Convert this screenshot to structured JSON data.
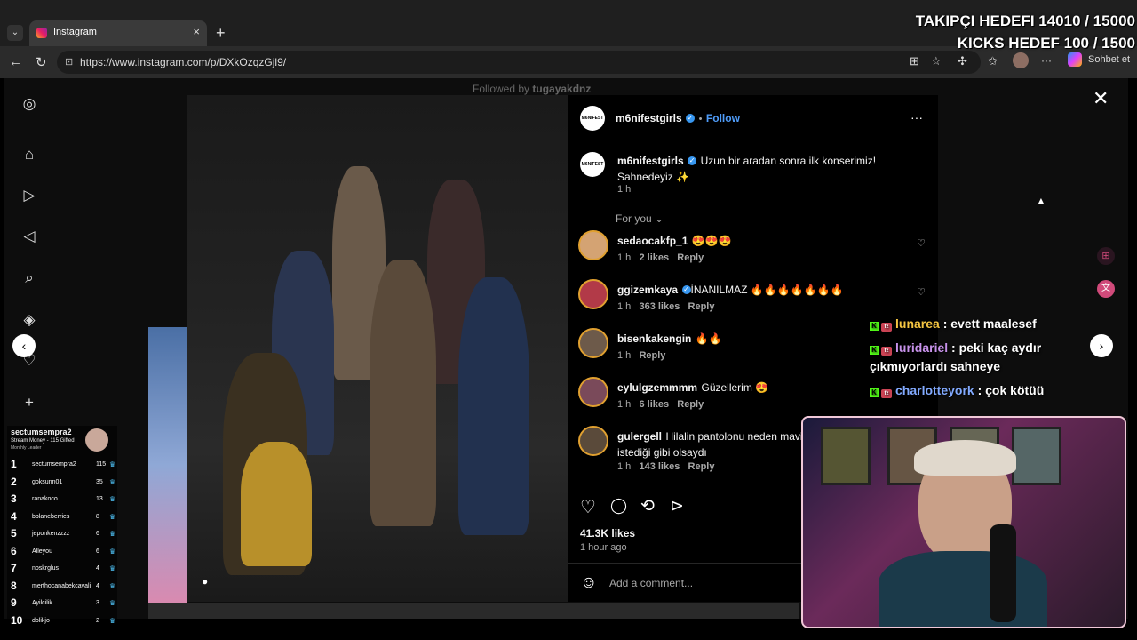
{
  "overlay": {
    "goal_followers": "TAKIPÇI HEDEFI 14010 / 15000",
    "goal_kicks": "KICKS HEDEF 100 / 1500"
  },
  "browser": {
    "tab_title": "Instagram",
    "tab_close": "×",
    "new_tab": "+",
    "url": "https://www.instagram.com/p/DXkOzqzGjl9/",
    "sidebar_btn": "Sohbet et",
    "back": "←",
    "reload": "↻",
    "menu": "···"
  },
  "instagram": {
    "followed_by_prefix": "Followed by",
    "followed_by_user": "tugayakdnz",
    "post": {
      "author": "m6nifestgirls",
      "follow_label": "Follow",
      "dot": "•",
      "more": "···",
      "caption_line1": "Uzun bir aradan sonra ilk konserimiz!",
      "caption_line2": "Sahnedeyiz ✨",
      "caption_time": "1 h",
      "sort_label": "For you",
      "likes": "41.3K likes",
      "time_ago": "1 hour ago",
      "add_comment_placeholder": "Add a comment...",
      "avatar_label": "M6NIFEST"
    },
    "comments": [
      {
        "user": "sedaocakfp_1",
        "text": "😍😍😍",
        "time": "1 h",
        "likes": "2 likes",
        "reply": "Reply",
        "verified": false,
        "avatar_color": "#d4a373"
      },
      {
        "user": "ggizemkaya",
        "text": "İNANILMAZ 🔥🔥🔥🔥🔥🔥🔥",
        "time": "1 h",
        "likes": "363 likes",
        "reply": "Reply",
        "verified": true,
        "avatar_color": "#b23a48"
      },
      {
        "user": "bisenkakengin",
        "text": "🔥🔥",
        "time": "1 h",
        "likes": "",
        "reply": "Reply",
        "verified": false,
        "avatar_color": "#6d5a4a"
      },
      {
        "user": "eylulgzemmmm",
        "text": "Güzellerim 😍",
        "time": "1 h",
        "likes": "6 likes",
        "reply": "Reply",
        "verified": false,
        "avatar_color": "#7a4a5a"
      },
      {
        "user": "gulergell",
        "text": "Hilalin pantolonu neden mavi",
        "text2": "istediği gibi olsaydı",
        "time": "1 h",
        "likes": "143 likes",
        "reply": "Reply",
        "verified": false,
        "avatar_color": "#5a4a3a"
      }
    ]
  },
  "chat": [
    {
      "user": "lunarea",
      "msg": ": evett maalesef",
      "color": "#f4c542"
    },
    {
      "user": "luridariel",
      "msg": ": peki kaç aydır",
      "msg2": "çıkmıyorlardı sahneye",
      "color": "#c792ea"
    },
    {
      "user": "charlotteyork",
      "msg": ": çok kötüü",
      "color": "#82aaff"
    }
  ],
  "leaderboard": {
    "streamer": "sectumsempra2",
    "subtitle": "Stream Money - 115 Gifted",
    "subtitle2": "Monthly Leader",
    "rows": [
      {
        "rank": "1",
        "name": "sectumsempra2",
        "value": "115"
      },
      {
        "rank": "2",
        "name": "goksunn01",
        "value": "35"
      },
      {
        "rank": "3",
        "name": "ranakoco",
        "value": "13"
      },
      {
        "rank": "4",
        "name": "bblaneberries",
        "value": "8"
      },
      {
        "rank": "5",
        "name": "jeponkenzzzz",
        "value": "6"
      },
      {
        "rank": "6",
        "name": "Alleyou",
        "value": "6"
      },
      {
        "rank": "7",
        "name": "noskrglus",
        "value": "4"
      },
      {
        "rank": "8",
        "name": "merthocanabekcavali",
        "value": "4"
      },
      {
        "rank": "9",
        "name": "Ayilcilik",
        "value": "3"
      },
      {
        "rank": "10",
        "name": "dolikjo",
        "value": "2"
      }
    ]
  },
  "icons": {
    "heart": "♡",
    "comment": "◯",
    "repost": "⟲",
    "share": "⊳",
    "emoji": "☺",
    "close": "✕",
    "prev": "‹",
    "next": "›"
  }
}
